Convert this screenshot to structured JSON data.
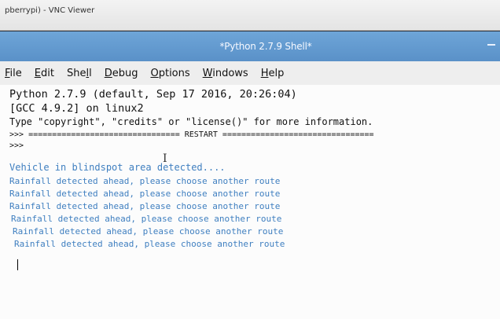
{
  "vnc": {
    "title": "pberrypi) - VNC Viewer"
  },
  "window": {
    "title": "*Python 2.7.9 Shell*"
  },
  "menu": {
    "items": [
      {
        "label": "File",
        "ul": "F",
        "rest": "ile"
      },
      {
        "label": "Edit",
        "ul": "E",
        "rest": "dit"
      },
      {
        "label": "Shell",
        "pre": "She",
        "ul": "l",
        "rest": "l"
      },
      {
        "label": "Debug",
        "ul": "D",
        "rest": "ebug"
      },
      {
        "label": "Options",
        "ul": "O",
        "rest": "ptions"
      },
      {
        "label": "Windows",
        "ul": "W",
        "rest": "indows"
      },
      {
        "label": "Help",
        "ul": "H",
        "rest": "elp"
      }
    ]
  },
  "shell": {
    "banner1": "Python 2.7.9 (default, Sep 17 2016, 20:26:04)",
    "banner2": "[GCC 4.9.2] on linux2",
    "banner3": "Type \"copyright\", \"credits\" or \"license()\" for more information.",
    "restart": ">>> ================================ RESTART ================================",
    "prompt": ">>>",
    "output": [
      "Vehicle in blindspot area detected....",
      "Rainfall detected ahead, please choose another route",
      "Rainfall detected ahead, please choose another route",
      "Rainfall detected ahead, please choose another route",
      "Rainfall detected ahead, please choose another route",
      "Rainfall detected ahead, please choose another route",
      "Rainfall detected ahead, please choose another route"
    ]
  }
}
